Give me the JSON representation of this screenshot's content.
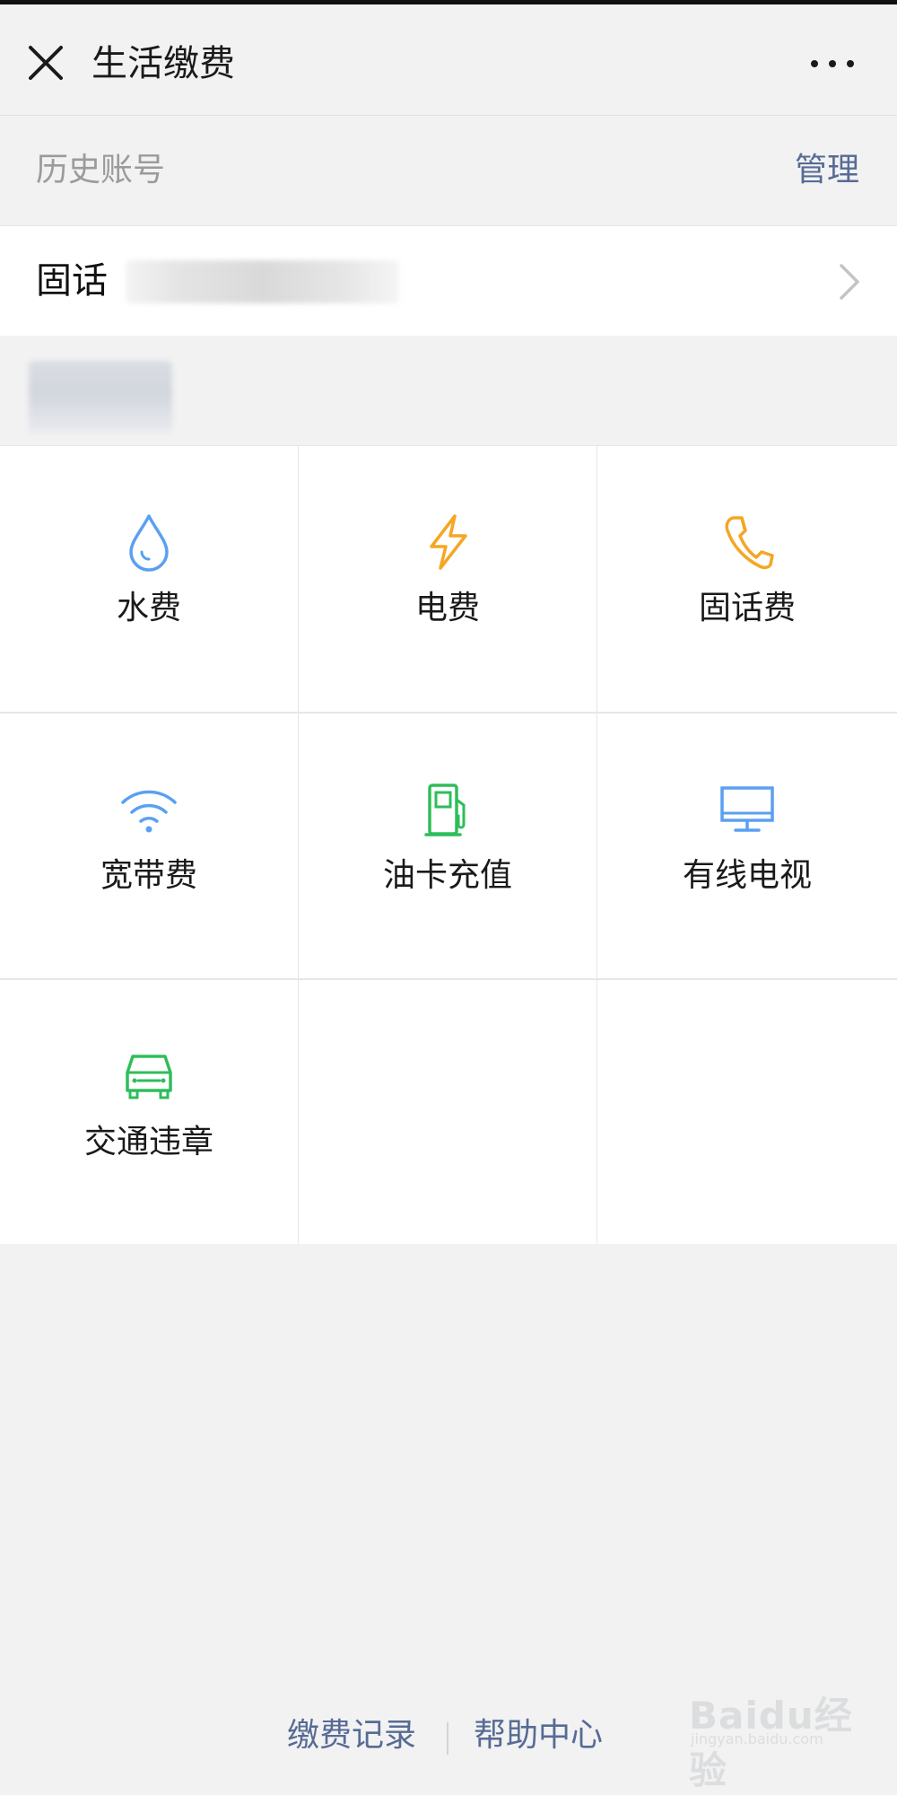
{
  "header": {
    "title": "生活缴费",
    "close_icon": "close-icon",
    "more_icon": "more-icon"
  },
  "history": {
    "label": "历史账号",
    "manage": "管理"
  },
  "account": {
    "type": "固话"
  },
  "services": [
    {
      "label": "水费",
      "icon": "water-drop-icon",
      "color": "#5aa0f0"
    },
    {
      "label": "电费",
      "icon": "lightning-icon",
      "color": "#f5a623"
    },
    {
      "label": "固话费",
      "icon": "phone-icon",
      "color": "#f5a623"
    },
    {
      "label": "宽带费",
      "icon": "wifi-icon",
      "color": "#5aa0f0"
    },
    {
      "label": "油卡充值",
      "icon": "fuel-pump-icon",
      "color": "#2fbd5a"
    },
    {
      "label": "有线电视",
      "icon": "tv-monitor-icon",
      "color": "#5aa0f0"
    },
    {
      "label": "交通违章",
      "icon": "car-icon",
      "color": "#2fbd5a"
    }
  ],
  "footer": {
    "records": "缴费记录",
    "help": "帮助中心"
  },
  "watermark": {
    "brand": "Baidu经验",
    "sub": "jingyan.baidu.com"
  },
  "colors": {
    "link": "#576b95",
    "background": "#f2f2f2",
    "blue": "#5aa0f0",
    "orange": "#f5a623",
    "green": "#2fbd5a"
  }
}
